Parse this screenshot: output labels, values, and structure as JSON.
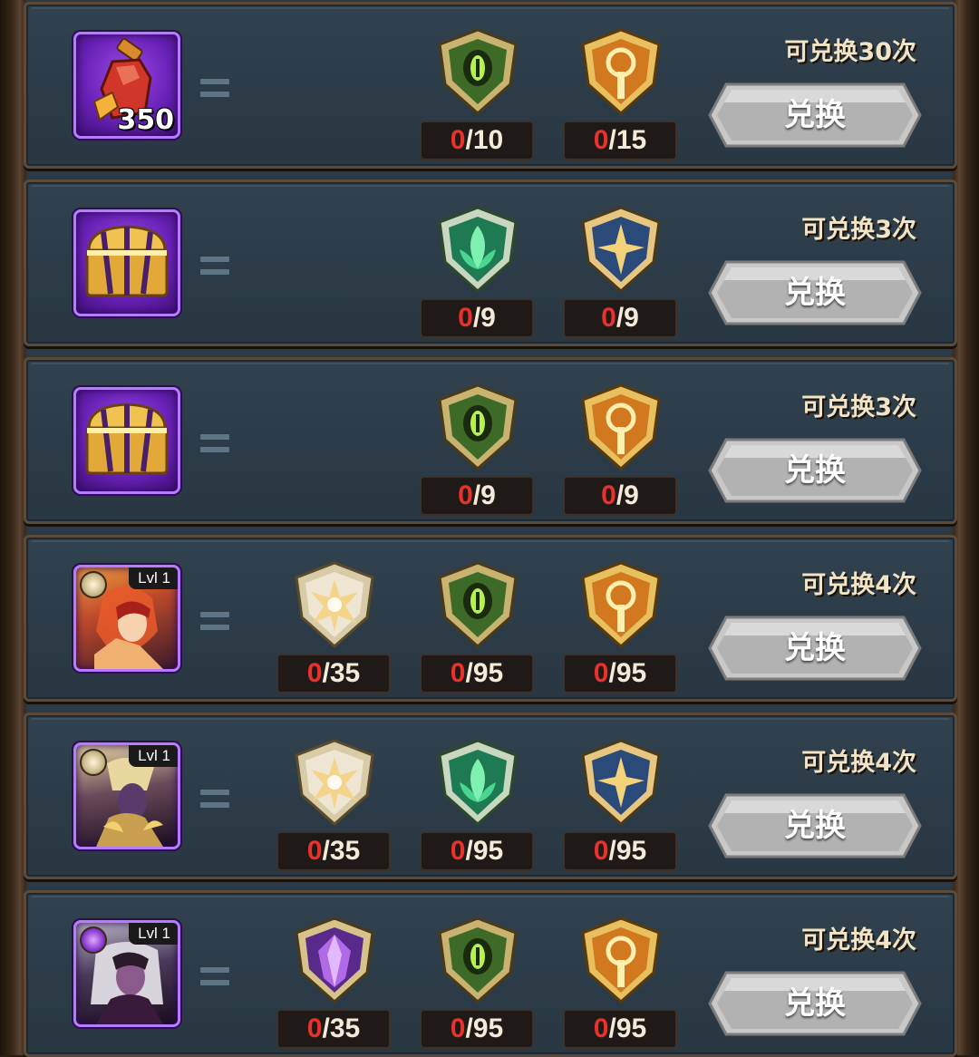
{
  "colors": {
    "row_bg": "#2c3c48",
    "frame_wood": "#5b4a38",
    "have_red": "#e8312a",
    "limit_text": "#f1e3c6",
    "reward_purple": "#6a22b8"
  },
  "rows": [
    {
      "reward": {
        "icon": "potion-icon",
        "count": "350"
      },
      "costs": [
        {
          "icon": "nature-eye-emblem-icon",
          "have": "0",
          "need": "/10"
        },
        {
          "icon": "gold-key-emblem-icon",
          "have": "0",
          "need": "/15"
        }
      ],
      "limit": "可兑换30次",
      "button": "兑换"
    },
    {
      "reward": {
        "icon": "gold-chest-icon",
        "count": ""
      },
      "costs": [
        {
          "icon": "green-leaf-emblem-icon",
          "have": "0",
          "need": "/9"
        },
        {
          "icon": "blue-star-emblem-icon",
          "have": "0",
          "need": "/9"
        }
      ],
      "limit": "可兑换3次",
      "button": "兑换"
    },
    {
      "reward": {
        "icon": "gold-chest-icon",
        "count": ""
      },
      "costs": [
        {
          "icon": "nature-eye-emblem-icon",
          "have": "0",
          "need": "/9"
        },
        {
          "icon": "gold-key-emblem-icon",
          "have": "0",
          "need": "/9"
        }
      ],
      "limit": "可兑换3次",
      "button": "兑换"
    },
    {
      "reward": {
        "icon": "hero-portrait-icon",
        "level": "Lvl 1"
      },
      "costs": [
        {
          "icon": "silver-star-emblem-icon",
          "have": "0",
          "need": "/35"
        },
        {
          "icon": "nature-eye-emblem-icon",
          "have": "0",
          "need": "/95"
        },
        {
          "icon": "gold-key-emblem-icon",
          "have": "0",
          "need": "/95"
        }
      ],
      "limit": "可兑换4次",
      "button": "兑换"
    },
    {
      "reward": {
        "icon": "hero-portrait-icon",
        "level": "Lvl 1"
      },
      "costs": [
        {
          "icon": "silver-star-emblem-icon",
          "have": "0",
          "need": "/35"
        },
        {
          "icon": "green-leaf-emblem-icon",
          "have": "0",
          "need": "/95"
        },
        {
          "icon": "blue-star-emblem-icon",
          "have": "0",
          "need": "/95"
        }
      ],
      "limit": "可兑换4次",
      "button": "兑换"
    },
    {
      "reward": {
        "icon": "hero-portrait-icon",
        "level": "Lvl 1"
      },
      "costs": [
        {
          "icon": "purple-crystal-emblem-icon",
          "have": "0",
          "need": "/35"
        },
        {
          "icon": "nature-eye-emblem-icon",
          "have": "0",
          "need": "/95"
        },
        {
          "icon": "gold-key-emblem-icon",
          "have": "0",
          "need": "/95"
        }
      ],
      "limit": "可兑换4次",
      "button": "兑换"
    }
  ]
}
